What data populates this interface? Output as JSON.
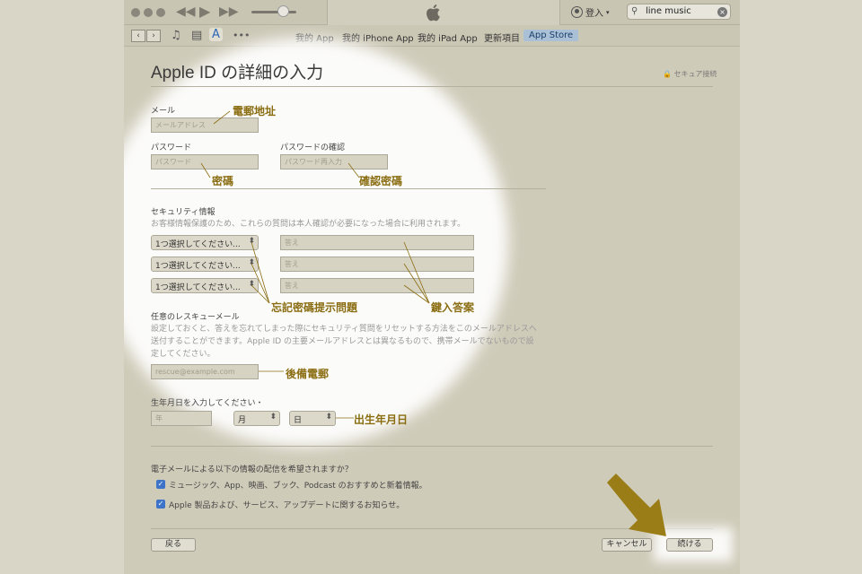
{
  "toolbar": {
    "volume": 0.7,
    "login_label": "登入",
    "search_value": "line music",
    "nav_tabs": [
      "我的 App",
      "我的 iPhone App",
      "我的 iPad App",
      "更新項目",
      "App Store"
    ],
    "active_tab": "App Store"
  },
  "page": {
    "title": "Apple ID の詳細の入力",
    "secure_label": "セキュア接続"
  },
  "form": {
    "email": {
      "label": "メール",
      "placeholder": "メールアドレス",
      "annotation": "電郵地址"
    },
    "password": {
      "label": "パスワード",
      "placeholder": "パスワード",
      "annotation": "密碼"
    },
    "confirm": {
      "label": "パスワードの確認",
      "placeholder": "パスワード再入力",
      "annotation": "確認密碼"
    },
    "security": {
      "label": "セキュリティ情報",
      "note": "お客様情報保護のため、これらの質問は本人確認が必要になった場合に利用されます。",
      "question_placeholder": "1つ選択してください...",
      "answer_placeholder": "答え",
      "annotation_questions": "忘記密碼提示問題",
      "annotation_answers": "鍵入答案"
    },
    "rescue": {
      "label": "任意のレスキューメール",
      "note_lines": [
        "設定しておくと、答えを忘れてしまった際にセキュリティ質問をリセットする方法をこのメールアドレスへ",
        "送付することができます。Apple ID の主要メールアドレスとは異なるもので、携帯メールでないもので設",
        "定してください。"
      ],
      "placeholder": "rescue@example.com",
      "annotation": "後備電郵"
    },
    "birthday": {
      "label": "生年月日を入力してください・",
      "year_placeholder": "年",
      "month_label": "月",
      "day_label": "日",
      "annotation": "出生年月日"
    },
    "newsletter": {
      "question": "電子メールによる以下の情報の配信を希望されますか？",
      "options": [
        "ミュージック、App、映画、ブック、Podcast のおすすめと新着情報。",
        "Apple 製品および、サービス、アップデートに関するお知らせ。"
      ]
    }
  },
  "buttons": {
    "back": "戻る",
    "cancel": "キャンセル",
    "continue": "続ける"
  },
  "colors": {
    "annotation": "#8a6d11",
    "arrow": "#9a7d17",
    "checkbox": "#3d73c9",
    "active_tab": "#a9c0d6"
  }
}
